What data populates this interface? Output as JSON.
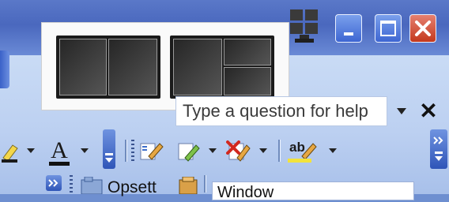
{
  "window_controls": {
    "minimize": "minimize",
    "maximize": "maximize",
    "close": "close"
  },
  "layout_popup": {
    "options": [
      "two-column-split",
      "left-pane-right-split"
    ]
  },
  "help": {
    "placeholder": "Type a question for help",
    "close_glyph": "✕"
  },
  "toolbar": {
    "icons": [
      "highlight-pen-icon",
      "font-color-icon",
      "edit-pen-icon",
      "format-pen-icon",
      "delete-mark-icon",
      "spell-check-icon"
    ],
    "font_color_label": "A",
    "spell_label": "ab"
  },
  "bottom": {
    "open_label": "Opsett",
    "window_label": "Window"
  },
  "colors": {
    "title_bar": "#4a68be",
    "ribbon": "#c2d6f4",
    "close_red": "#c4391d"
  }
}
